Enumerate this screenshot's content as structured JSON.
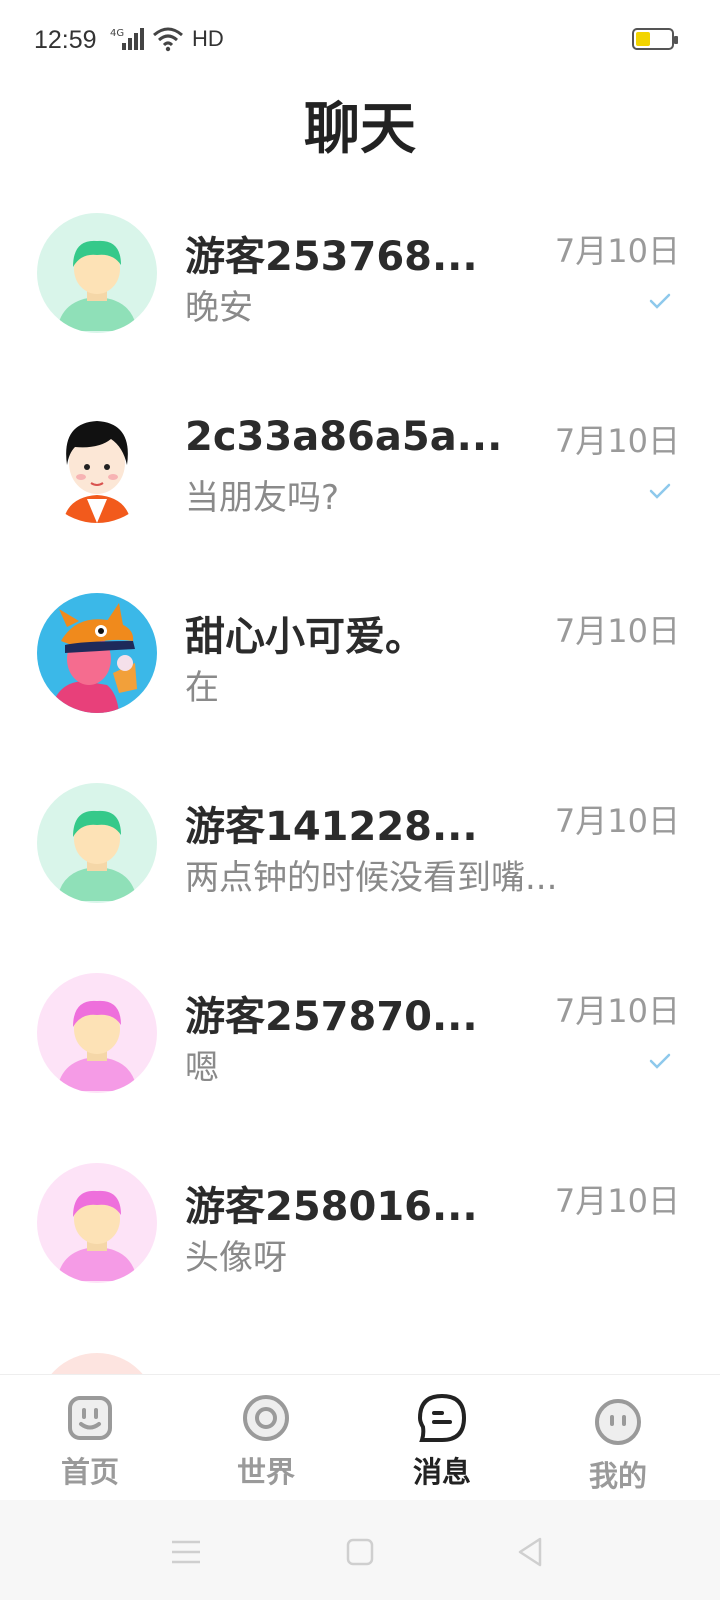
{
  "status_bar": {
    "time": "12:59",
    "network": "4G",
    "hd": "HD",
    "battery_level": 0.4
  },
  "page_title": "聊天",
  "chats": [
    {
      "name": "游客253768...",
      "preview": "晚安",
      "date": "7月10日",
      "read": true,
      "avatar": "green-default-avatar"
    },
    {
      "name": "2c33a86a5a...",
      "preview": "当朋友吗?",
      "date": "7月10日",
      "read": true,
      "avatar": "cartoon-boy-avatar"
    },
    {
      "name": "甜心小可爱。",
      "preview": "在",
      "date": "7月10日",
      "read": false,
      "avatar": "illustrated-girl-avatar"
    },
    {
      "name": "游客141228...",
      "preview": "两点钟的时候没看到嘴...",
      "date": "7月10日",
      "read": false,
      "avatar": "green-default-avatar"
    },
    {
      "name": "游客257870...",
      "preview": "嗯",
      "date": "7月10日",
      "read": true,
      "avatar": "pink-default-avatar"
    },
    {
      "name": "游客258016...",
      "preview": "头像呀",
      "date": "7月10日",
      "read": false,
      "avatar": "pink-default-avatar"
    }
  ],
  "bottom_nav": [
    {
      "label": "首页",
      "icon": "home-face-icon",
      "active": false
    },
    {
      "label": "世界",
      "icon": "world-ring-icon",
      "active": false
    },
    {
      "label": "消息",
      "icon": "message-bubble-icon",
      "active": true
    },
    {
      "label": "我的",
      "icon": "profile-face-icon",
      "active": false
    }
  ],
  "colors": {
    "accent_check": "#8ec9ec",
    "battery": "#f2d400",
    "green_avatar_bg": "#d9f5ea",
    "pink_avatar_bg": "#fde3f7"
  }
}
